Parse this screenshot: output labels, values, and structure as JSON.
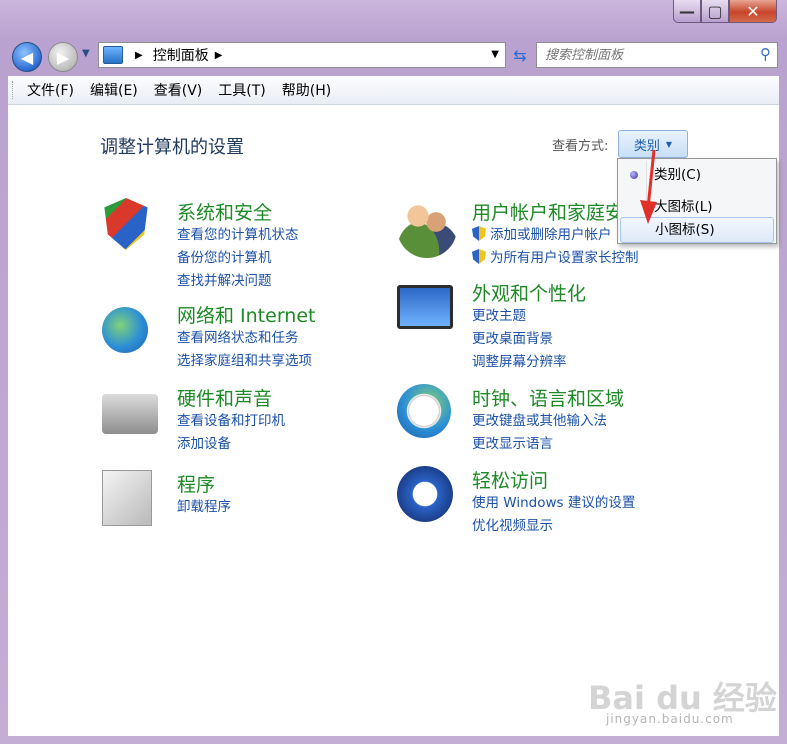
{
  "nav": {
    "address_items": [
      "控制面板"
    ],
    "search_placeholder": "搜索控制面板"
  },
  "menu": [
    "文件(F)",
    "编辑(E)",
    "查看(V)",
    "工具(T)",
    "帮助(H)"
  ],
  "content": {
    "heading": "调整计算机的设置",
    "view_by_label": "查看方式:",
    "view_by_value": "类别"
  },
  "categories": [
    {
      "title": "系统和安全",
      "icon": "security-shield-icon",
      "links": [
        "查看您的计算机状态",
        "备份您的计算机",
        "查找并解决问题"
      ]
    },
    {
      "title": "用户帐户和家庭安",
      "icon": "users-icon",
      "links": [
        "添加或删除用户帐户",
        "为所有用户设置家长控制"
      ]
    },
    {
      "title": "网络和 Internet",
      "icon": "network-globe-icon",
      "links": [
        "查看网络状态和任务",
        "选择家庭组和共享选项"
      ]
    },
    {
      "title": "外观和个性化",
      "icon": "monitor-palette-icon",
      "links": [
        "更改主题",
        "更改桌面背景",
        "调整屏幕分辨率"
      ]
    },
    {
      "title": "硬件和声音",
      "icon": "printer-icon",
      "links": [
        "查看设备和打印机",
        "添加设备"
      ]
    },
    {
      "title": "时钟、语言和区域",
      "icon": "clock-globe-icon",
      "links": [
        "更改键盘或其他输入法",
        "更改显示语言"
      ]
    },
    {
      "title": "程序",
      "icon": "programs-box-icon",
      "links": [
        "卸载程序"
      ]
    },
    {
      "title": "轻松访问",
      "icon": "accessibility-icon",
      "links": [
        "使用 Windows 建议的设置",
        "优化视频显示"
      ]
    }
  ],
  "dropdown": {
    "items": [
      "类别(C)",
      "大图标(L)",
      "小图标(S)"
    ],
    "selected": "类别(C)",
    "hovered": "小图标(S)"
  },
  "watermark": {
    "text": "Bai du 经验",
    "url": "jingyan.baidu.com"
  },
  "colors": {
    "category_title": "#1e8a26",
    "link": "#1c51a8",
    "heading": "#1e395b",
    "annotation_arrow": "#e0302a"
  }
}
